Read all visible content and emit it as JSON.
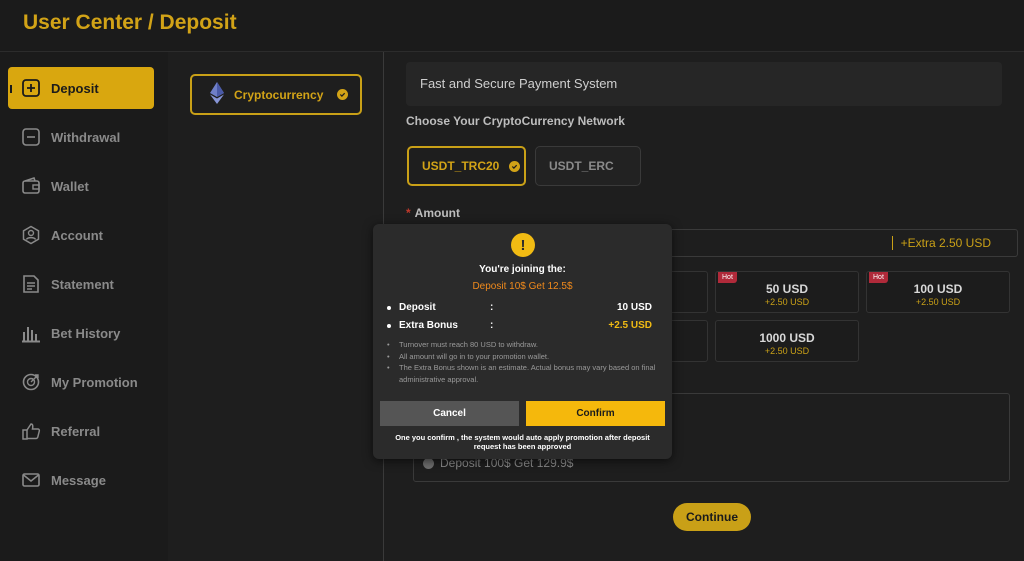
{
  "header": {
    "title": "User Center / Deposit"
  },
  "sidebar": {
    "items": [
      {
        "label": "Deposit",
        "icon": "plus-square-icon"
      },
      {
        "label": "Withdrawal",
        "icon": "minus-square-icon"
      },
      {
        "label": "Wallet",
        "icon": "wallet-icon"
      },
      {
        "label": "Account",
        "icon": "account-icon"
      },
      {
        "label": "Statement",
        "icon": "statement-icon"
      },
      {
        "label": "Bet History",
        "icon": "bar-chart-icon"
      },
      {
        "label": "My Promotion",
        "icon": "promotion-icon"
      },
      {
        "label": "Referral",
        "icon": "thumbs-up-icon"
      },
      {
        "label": "Message",
        "icon": "mail-icon"
      }
    ]
  },
  "methods": {
    "crypto_label": "Cryptocurrency"
  },
  "main": {
    "payment_title": "Fast and Secure Payment System",
    "network_label": "Choose Your CryptoCurrency Network",
    "networks": [
      "USDT_TRC20",
      "USDT_ERC"
    ],
    "amount_label": "Amount",
    "amount_required_mark": "*",
    "amount_extra": "+Extra 2.50 USD",
    "amount_options": [
      {
        "amount": "50 USD",
        "bonus": "+2.50 USD",
        "badge": "Hot"
      },
      {
        "amount": "100 USD",
        "bonus": "+2.50 USD",
        "badge": "Hot"
      },
      {
        "amount": "1000 USD",
        "bonus": "+2.50 USD"
      }
    ],
    "promo_option": "Deposit 100$ Get 129.9$",
    "continue_label": "Continue"
  },
  "modal": {
    "icon": "exclamation-icon",
    "title": "You're joining the:",
    "promo_name": "Deposit 10$ Get 12.5$",
    "rows": [
      {
        "label": "Deposit",
        "colon": ":",
        "value": "10 USD"
      },
      {
        "label": "Extra Bonus",
        "colon": ":",
        "value": "+2.5 USD"
      }
    ],
    "notes": [
      "Turnover must reach 80 USD to withdraw.",
      "All amount will go in to your promotion wallet.",
      "The Extra Bonus shown is an estimate. Actual bonus may vary based on final administrative approval."
    ],
    "cancel_label": "Cancel",
    "confirm_label": "Confirm",
    "footer": "One you confirm , the system would auto apply promotion after deposit request has been approved"
  },
  "colors": {
    "accent": "#d9a70f",
    "bonus": "#f1bb13",
    "promo": "#f08a1c",
    "hot": "#b02a3a"
  }
}
